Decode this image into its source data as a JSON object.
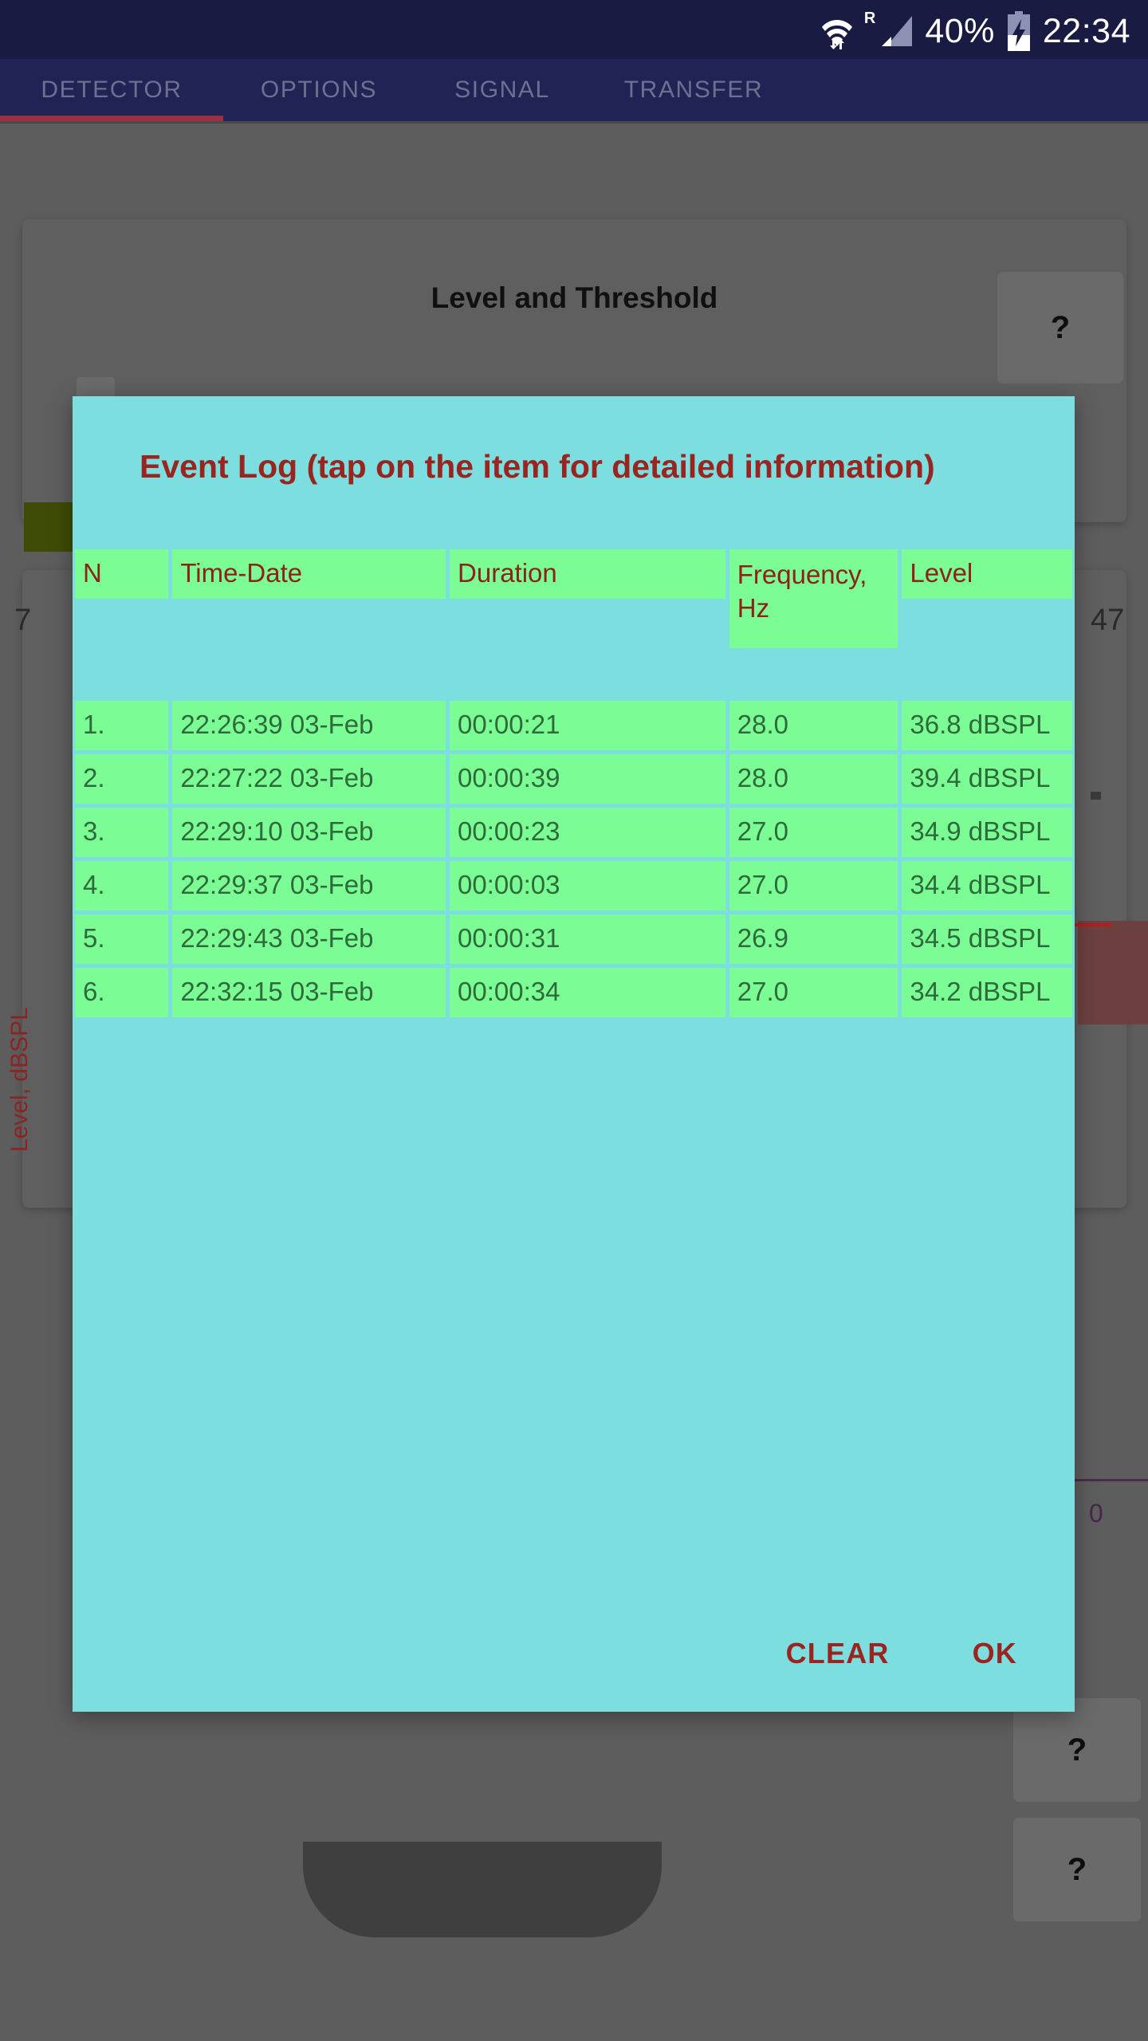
{
  "statusbar": {
    "wifi_icon": "wifi-icon",
    "roaming_label": "R",
    "signal_icon": "cellular-signal-icon",
    "battery_percent": "40%",
    "battery_icon": "battery-charging-icon",
    "time": "22:34"
  },
  "tabs": [
    {
      "label": "DETECTOR",
      "selected": true
    },
    {
      "label": "OPTIONS",
      "selected": false
    },
    {
      "label": "SIGNAL",
      "selected": false
    },
    {
      "label": "TRANSFER",
      "selected": false
    }
  ],
  "background": {
    "card_title": "Level and Threshold",
    "help_label": "?",
    "axis_label": "Level, dBSPL",
    "left_value": "7",
    "right_value": "47",
    "bottom_value": "0"
  },
  "dialog": {
    "title": "Event Log (tap on the item for detailed information)",
    "headers": [
      "N",
      "Time-Date",
      "Duration",
      "Frequency, Hz",
      "Level"
    ],
    "rows": [
      {
        "n": "1.",
        "time": "22:26:39 03-Feb",
        "duration": "00:00:21",
        "frequency": "28.0",
        "level": "36.8 dBSPL"
      },
      {
        "n": "2.",
        "time": "22:27:22 03-Feb",
        "duration": "00:00:39",
        "frequency": "28.0",
        "level": "39.4 dBSPL"
      },
      {
        "n": "3.",
        "time": "22:29:10 03-Feb",
        "duration": "00:00:23",
        "frequency": "27.0",
        "level": "34.9 dBSPL"
      },
      {
        "n": "4.",
        "time": "22:29:37 03-Feb",
        "duration": "00:00:03",
        "frequency": "27.0",
        "level": "34.4 dBSPL"
      },
      {
        "n": "5.",
        "time": "22:29:43 03-Feb",
        "duration": "00:00:31",
        "frequency": "26.9",
        "level": "34.5 dBSPL"
      },
      {
        "n": "6.",
        "time": "22:32:15 03-Feb",
        "duration": "00:00:34",
        "frequency": "27.0",
        "level": "34.2 dBSPL"
      }
    ],
    "clear_label": "CLEAR",
    "ok_label": "OK"
  },
  "colors": {
    "statusbar_bg": "#191b42",
    "appbar_bg": "#212354",
    "tab_text": "#6d7090",
    "tab_indicator": "#9c3040",
    "dialog_bg": "#7cdede",
    "cell_bg": "#7cfc94",
    "header_text": "#8a2318",
    "cell_text": "#2d6b3a",
    "accent_red": "#9a2420",
    "scrim": "#5d5d5d"
  }
}
